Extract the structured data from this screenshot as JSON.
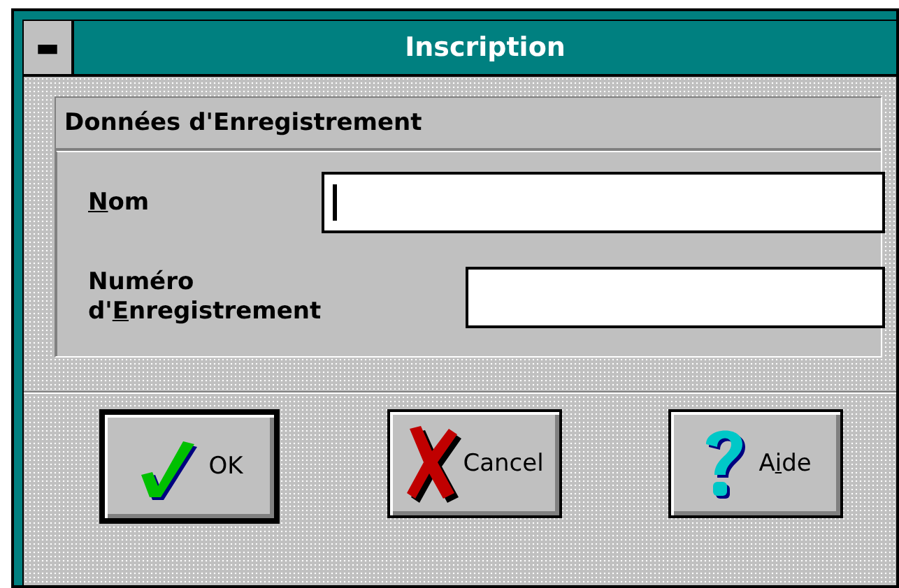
{
  "window": {
    "title": "Inscription",
    "system_menu": "▬"
  },
  "group": {
    "title": "Données d'Enregistrement"
  },
  "fields": [
    {
      "label": {
        "key": "N",
        "after": "om"
      },
      "focused": true
    },
    {
      "label": {
        "before": "Numéro\nd'",
        "key": "E",
        "after": "nregistrement"
      },
      "focused": false
    }
  ],
  "buttons": [
    {
      "kind": "ok",
      "label": {
        "after": "OK"
      },
      "default": true
    },
    {
      "kind": "cancel",
      "label": {
        "after": "Cancel"
      },
      "default": false
    },
    {
      "kind": "help",
      "label": {
        "before": "A",
        "key": "i",
        "after": "de"
      },
      "default": false
    }
  ]
}
